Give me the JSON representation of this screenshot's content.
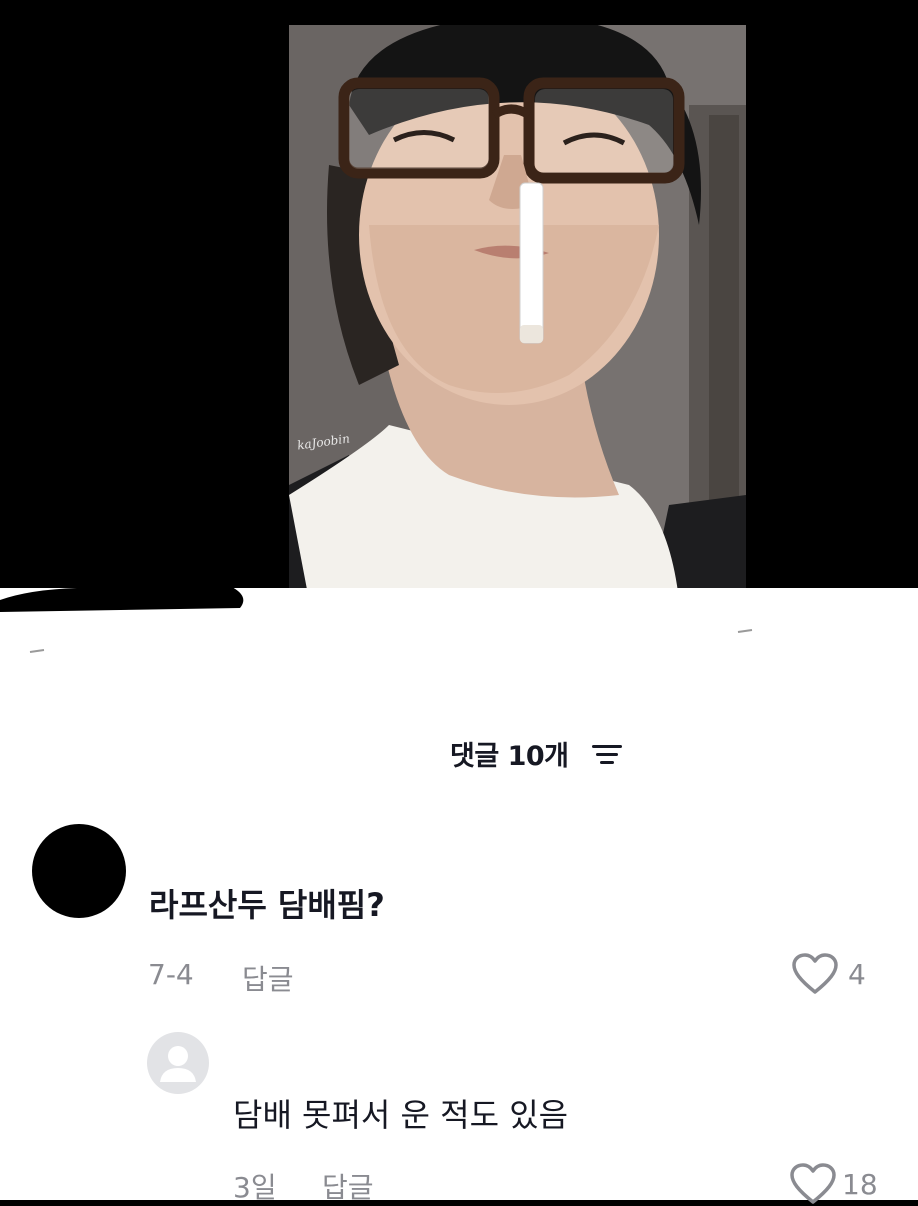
{
  "video": {
    "watermark": "kaJoobin"
  },
  "comments_header": {
    "title": "댓글 10개",
    "filter_icon": "filter-icon"
  },
  "comments": [
    {
      "text": "라프산두 담배핌?",
      "date": "7-4",
      "reply_label": "답글",
      "likes": "4",
      "avatar": "black-avatar"
    },
    {
      "text": "담배 못펴서 운 적도 있음",
      "date": "3일",
      "reply_label": "답글",
      "likes": "18",
      "avatar": "default-user-avatar"
    }
  ],
  "colors": {
    "background_top": "#000000",
    "sheet": "#ffffff",
    "primary_text": "#161823",
    "secondary_text": "#8a8b91"
  }
}
